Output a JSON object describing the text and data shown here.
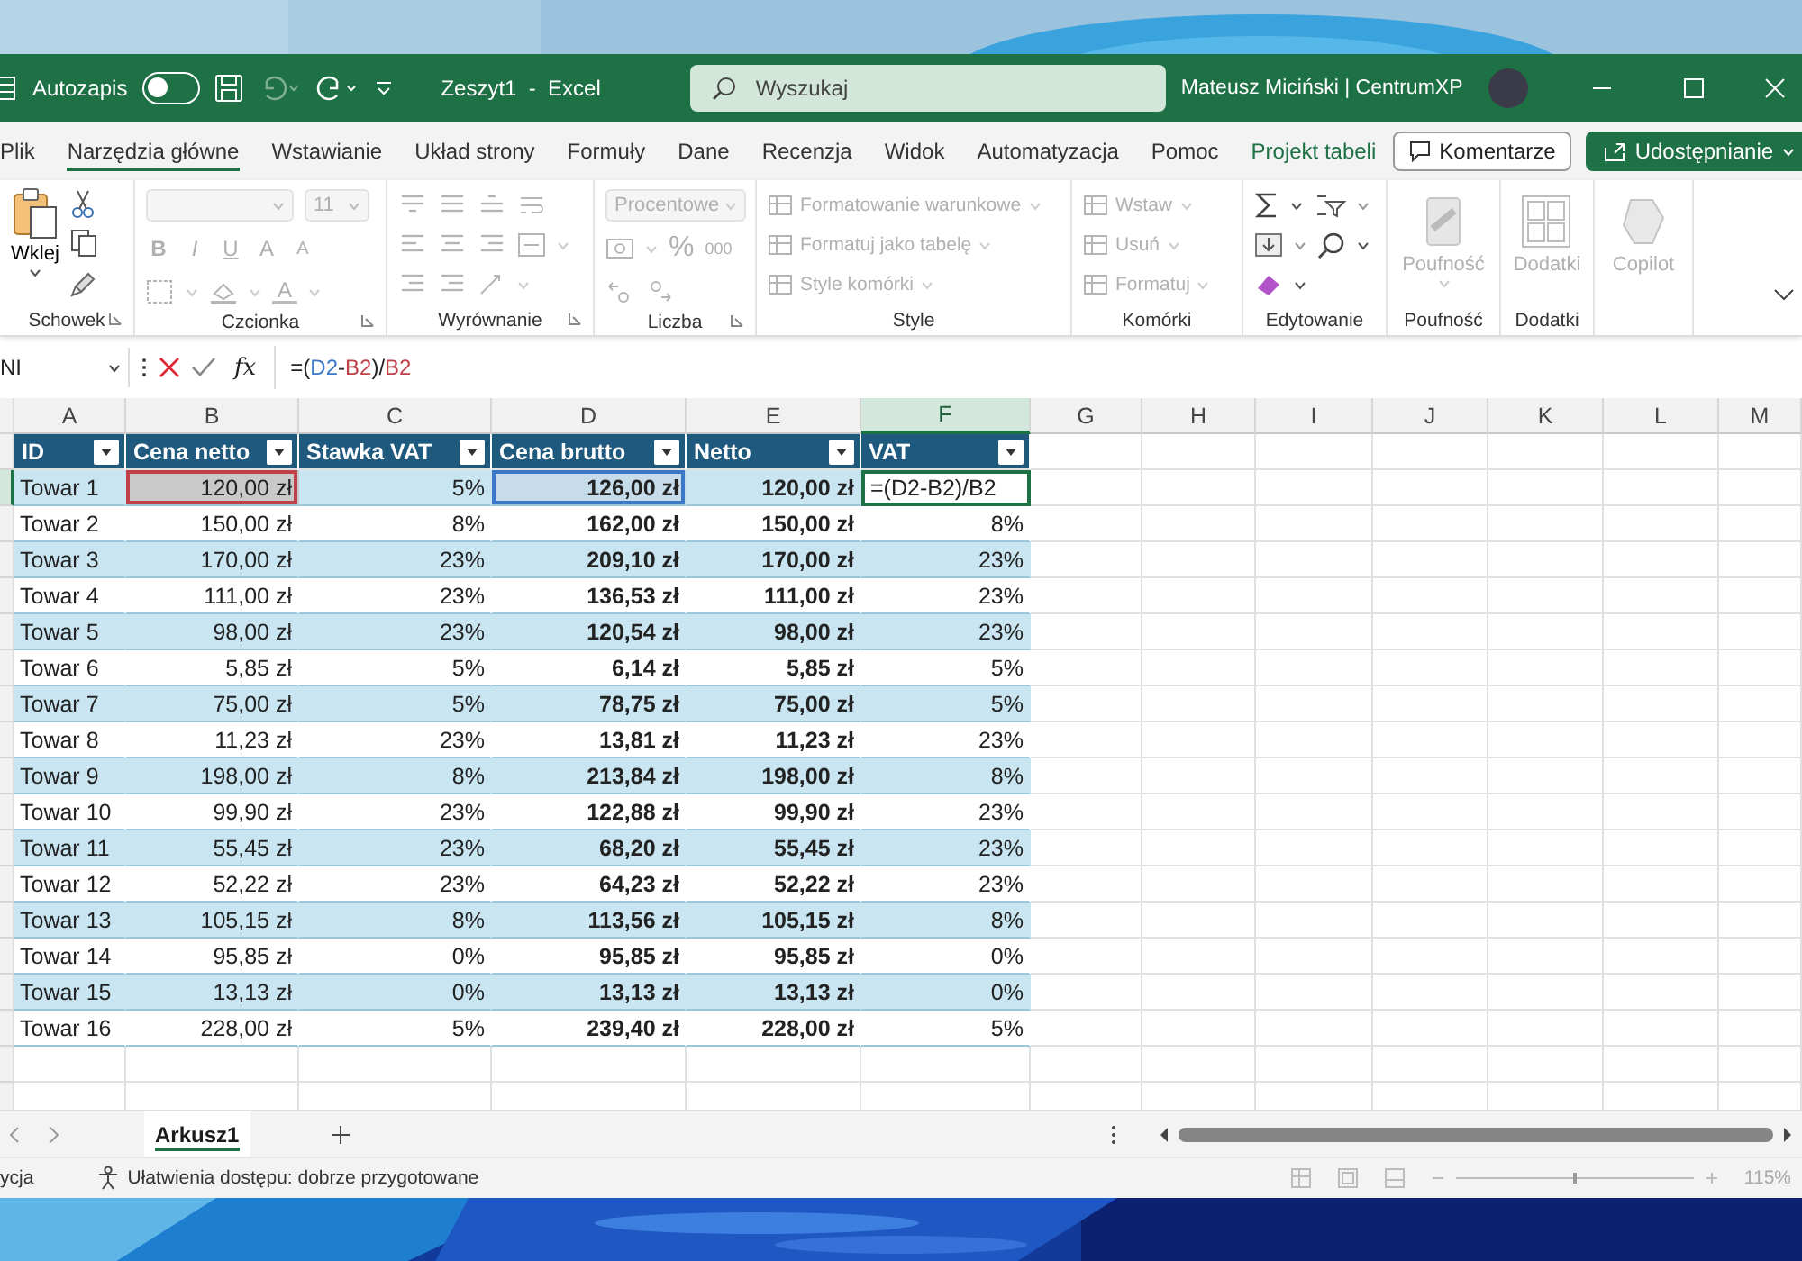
{
  "title_bar": {
    "autosave_label": "Autozapis",
    "autosave_on": false,
    "document_title": "Zeszyt1  -  Excel",
    "search_placeholder": "Wyszukaj",
    "user": "Mateusz Miciński | CentrumXP"
  },
  "ribbon_tabs": [
    {
      "label": "Plik",
      "selected": false,
      "contextual": false
    },
    {
      "label": "Narzędzia główne",
      "selected": true,
      "contextual": false
    },
    {
      "label": "Wstawianie",
      "selected": false,
      "contextual": false
    },
    {
      "label": "Układ strony",
      "selected": false,
      "contextual": false
    },
    {
      "label": "Formuły",
      "selected": false,
      "contextual": false
    },
    {
      "label": "Dane",
      "selected": false,
      "contextual": false
    },
    {
      "label": "Recenzja",
      "selected": false,
      "contextual": false
    },
    {
      "label": "Widok",
      "selected": false,
      "contextual": false
    },
    {
      "label": "Automatyzacja",
      "selected": false,
      "contextual": false
    },
    {
      "label": "Pomoc",
      "selected": false,
      "contextual": false
    },
    {
      "label": "Projekt tabeli",
      "selected": false,
      "contextual": true
    }
  ],
  "comments_button": "Komentarze",
  "share_button": "Udostępnianie",
  "ribbon": {
    "groups": [
      {
        "kind": "clipboard",
        "label": "Schowek",
        "paste": "Wklej",
        "disabled": false
      },
      {
        "kind": "font",
        "label": "Czcionka",
        "font_size": "11",
        "font_buttons": [
          "B",
          "I",
          "U",
          "A",
          "A"
        ],
        "color_button": "A",
        "disabled": true
      },
      {
        "kind": "alignment",
        "label": "Wyrównanie",
        "disabled": true
      },
      {
        "kind": "number",
        "label": "Liczba",
        "format": "Procentowe",
        "percent": "%",
        "thousands": "000",
        "disabled": true
      },
      {
        "kind": "list",
        "label": "Style",
        "items": [
          "Formatowanie warunkowe",
          "Formatuj jako tabelę",
          "Style komórki"
        ],
        "disabled": true
      },
      {
        "kind": "list",
        "label": "Komórki",
        "items": [
          "Wstaw",
          "Usuń",
          "Formatuj"
        ],
        "disabled": true
      },
      {
        "kind": "editing",
        "label": "Edytowanie",
        "disabled": false
      },
      {
        "kind": "large",
        "label": "Poufność",
        "button": "Poufność",
        "disabled": true
      },
      {
        "kind": "large",
        "label": "Dodatki",
        "button": "Dodatki",
        "disabled": true
      },
      {
        "kind": "large",
        "button": "Copilot",
        "disabled": true
      }
    ]
  },
  "formula_bar": {
    "name_box": "NI",
    "function_label": "fx",
    "formula": [
      {
        "text": "=(",
        "color": "#222222"
      },
      {
        "text": "D2",
        "color": "#3c78c8"
      },
      {
        "text": "-",
        "color": "#222222"
      },
      {
        "text": "B2",
        "color": "#c0404a"
      },
      {
        "text": ")/",
        "color": "#222222"
      },
      {
        "text": "B2",
        "color": "#c0404a"
      }
    ]
  },
  "column_letters": [
    "A",
    "B",
    "C",
    "D",
    "E",
    "F",
    "G",
    "H",
    "I",
    "J",
    "K",
    "L",
    "M"
  ],
  "table": {
    "columns": [
      "ID",
      "Cena netto",
      "Stawka VAT",
      "Cena brutto",
      "Netto",
      "VAT"
    ],
    "rows": [
      {
        "cells": [
          {
            "text": "Towar 1",
            "selected": false
          },
          {
            "text": "120,00 zł",
            "selected": false,
            "color": "#c0404a"
          },
          {
            "text": "5%",
            "selected": false
          },
          {
            "text": "126,00 zł",
            "selected": false,
            "color": "#3c78c8"
          },
          {
            "text": "120,00 zł",
            "selected": false
          },
          {
            "text": "=(D2-B2)/B2",
            "selected": true
          }
        ]
      },
      {
        "cells": [
          {
            "text": "Towar 2",
            "selected": false
          },
          {
            "text": "150,00 zł",
            "selected": false
          },
          {
            "text": "8%",
            "selected": false
          },
          {
            "text": "162,00 zł",
            "selected": false
          },
          {
            "text": "150,00 zł",
            "selected": false
          },
          {
            "text": "8%",
            "selected": false
          }
        ]
      },
      {
        "cells": [
          {
            "text": "Towar 3",
            "selected": false
          },
          {
            "text": "170,00 zł",
            "selected": false
          },
          {
            "text": "23%",
            "selected": false
          },
          {
            "text": "209,10 zł",
            "selected": false
          },
          {
            "text": "170,00 zł",
            "selected": false
          },
          {
            "text": "23%",
            "selected": false
          }
        ]
      },
      {
        "cells": [
          {
            "text": "Towar 4",
            "selected": false
          },
          {
            "text": "111,00 zł",
            "selected": false
          },
          {
            "text": "23%",
            "selected": false
          },
          {
            "text": "136,53 zł",
            "selected": false
          },
          {
            "text": "111,00 zł",
            "selected": false
          },
          {
            "text": "23%",
            "selected": false
          }
        ]
      },
      {
        "cells": [
          {
            "text": "Towar 5",
            "selected": false
          },
          {
            "text": "98,00 zł",
            "selected": false
          },
          {
            "text": "23%",
            "selected": false
          },
          {
            "text": "120,54 zł",
            "selected": false
          },
          {
            "text": "98,00 zł",
            "selected": false
          },
          {
            "text": "23%",
            "selected": false
          }
        ]
      },
      {
        "cells": [
          {
            "text": "Towar 6",
            "selected": false
          },
          {
            "text": "5,85 zł",
            "selected": false
          },
          {
            "text": "5%",
            "selected": false
          },
          {
            "text": "6,14 zł",
            "selected": false
          },
          {
            "text": "5,85 zł",
            "selected": false
          },
          {
            "text": "5%",
            "selected": false
          }
        ]
      },
      {
        "cells": [
          {
            "text": "Towar 7",
            "selected": false
          },
          {
            "text": "75,00 zł",
            "selected": false
          },
          {
            "text": "5%",
            "selected": false
          },
          {
            "text": "78,75 zł",
            "selected": false
          },
          {
            "text": "75,00 zł",
            "selected": false
          },
          {
            "text": "5%",
            "selected": false
          }
        ]
      },
      {
        "cells": [
          {
            "text": "Towar 8",
            "selected": false
          },
          {
            "text": "11,23 zł",
            "selected": false
          },
          {
            "text": "23%",
            "selected": false
          },
          {
            "text": "13,81 zł",
            "selected": false
          },
          {
            "text": "11,23 zł",
            "selected": false
          },
          {
            "text": "23%",
            "selected": false
          }
        ]
      },
      {
        "cells": [
          {
            "text": "Towar 9",
            "selected": false
          },
          {
            "text": "198,00 zł",
            "selected": false
          },
          {
            "text": "8%",
            "selected": false
          },
          {
            "text": "213,84 zł",
            "selected": false
          },
          {
            "text": "198,00 zł",
            "selected": false
          },
          {
            "text": "8%",
            "selected": false
          }
        ]
      },
      {
        "cells": [
          {
            "text": "Towar 10",
            "selected": false
          },
          {
            "text": "99,90 zł",
            "selected": false
          },
          {
            "text": "23%",
            "selected": false
          },
          {
            "text": "122,88 zł",
            "selected": false
          },
          {
            "text": "99,90 zł",
            "selected": false
          },
          {
            "text": "23%",
            "selected": false
          }
        ]
      },
      {
        "cells": [
          {
            "text": "Towar 11",
            "selected": false
          },
          {
            "text": "55,45 zł",
            "selected": false
          },
          {
            "text": "23%",
            "selected": false
          },
          {
            "text": "68,20 zł",
            "selected": false
          },
          {
            "text": "55,45 zł",
            "selected": false
          },
          {
            "text": "23%",
            "selected": false
          }
        ]
      },
      {
        "cells": [
          {
            "text": "Towar 12",
            "selected": false
          },
          {
            "text": "52,22 zł",
            "selected": false
          },
          {
            "text": "23%",
            "selected": false
          },
          {
            "text": "64,23 zł",
            "selected": false
          },
          {
            "text": "52,22 zł",
            "selected": false
          },
          {
            "text": "23%",
            "selected": false
          }
        ]
      },
      {
        "cells": [
          {
            "text": "Towar 13",
            "selected": false
          },
          {
            "text": "105,15 zł",
            "selected": false
          },
          {
            "text": "8%",
            "selected": false
          },
          {
            "text": "113,56 zł",
            "selected": false
          },
          {
            "text": "105,15 zł",
            "selected": false
          },
          {
            "text": "8%",
            "selected": false
          }
        ]
      },
      {
        "cells": [
          {
            "text": "Towar 14",
            "selected": false
          },
          {
            "text": "95,85 zł",
            "selected": false
          },
          {
            "text": "0%",
            "selected": false
          },
          {
            "text": "95,85 zł",
            "selected": false
          },
          {
            "text": "95,85 zł",
            "selected": false
          },
          {
            "text": "0%",
            "selected": false
          }
        ]
      },
      {
        "cells": [
          {
            "text": "Towar 15",
            "selected": false
          },
          {
            "text": "13,13 zł",
            "selected": false
          },
          {
            "text": "0%",
            "selected": false
          },
          {
            "text": "13,13 zł",
            "selected": false
          },
          {
            "text": "13,13 zł",
            "selected": false
          },
          {
            "text": "0%",
            "selected": false
          }
        ]
      },
      {
        "cells": [
          {
            "text": "Towar 16",
            "selected": false
          },
          {
            "text": "228,00 zł",
            "selected": false
          },
          {
            "text": "5%",
            "selected": false
          },
          {
            "text": "239,40 zł",
            "selected": false
          },
          {
            "text": "228,00 zł",
            "selected": false
          },
          {
            "text": "5%",
            "selected": false
          }
        ]
      }
    ]
  },
  "sheet_tabs": [
    {
      "label": "Arkusz1",
      "selected": true
    }
  ],
  "status_bar": {
    "mode": "ycja",
    "accessibility": "Ułatwienia dostępu: dobrze przygotowane",
    "zoom": "115%"
  }
}
